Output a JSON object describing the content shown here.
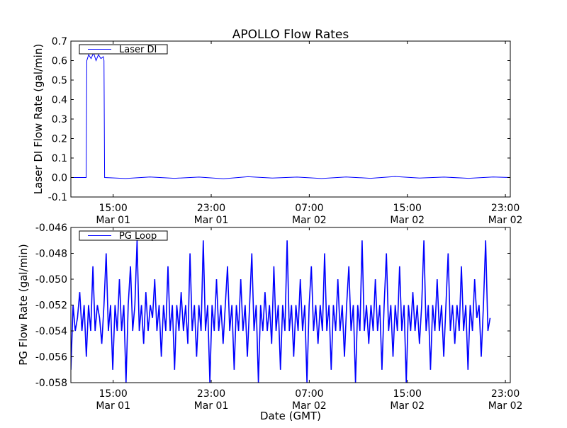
{
  "chart_data": [
    {
      "type": "line",
      "title": "APOLLO Flow Rates",
      "ylabel": "Laser DI Flow Rate (gal/min)",
      "xlabel": "",
      "x_unit": "hours since Mar 01 00:00 GMT",
      "xlim": [
        11.55,
        47.4
      ],
      "ylim": [
        -0.1,
        0.7
      ],
      "yticks": [
        "-0.1",
        "0.0",
        "0.1",
        "0.2",
        "0.3",
        "0.4",
        "0.5",
        "0.6",
        "0.7"
      ],
      "ytick_values": [
        -0.1,
        0.0,
        0.1,
        0.2,
        0.3,
        0.4,
        0.5,
        0.6,
        0.7
      ],
      "xticks": [
        {
          "value": 15,
          "time": "15:00",
          "date": "Mar 01"
        },
        {
          "value": 23,
          "time": "23:00",
          "date": "Mar 01"
        },
        {
          "value": 31,
          "time": "07:00",
          "date": "Mar 02"
        },
        {
          "value": 39,
          "time": "15:00",
          "date": "Mar 02"
        },
        {
          "value": 47,
          "time": "23:00",
          "date": "Mar 02"
        }
      ],
      "legend": {
        "position": "top-left",
        "entries": [
          "Laser DI"
        ]
      },
      "grid": false,
      "series": [
        {
          "name": "Laser DI",
          "color": "#0000ff",
          "x": [
            11.55,
            12.8,
            12.85,
            13.0,
            13.2,
            13.4,
            13.6,
            13.8,
            14.0,
            14.2,
            14.25,
            14.3,
            16,
            18,
            20,
            22,
            24,
            26,
            28,
            30,
            32,
            34,
            36,
            38,
            40,
            42,
            44,
            46,
            47.4
          ],
          "y": [
            0.0,
            0.0,
            0.6,
            0.63,
            0.61,
            0.64,
            0.6,
            0.63,
            0.61,
            0.62,
            0.6,
            0.0,
            -0.005,
            0.003,
            -0.004,
            0.002,
            -0.006,
            0.004,
            -0.003,
            0.002,
            -0.005,
            0.003,
            -0.004,
            0.005,
            -0.003,
            0.002,
            -0.004,
            0.003,
            0.0
          ]
        }
      ]
    },
    {
      "type": "line",
      "title": "",
      "ylabel": "PG Flow Rate (gal/min)",
      "xlabel": "Date (GMT)",
      "x_unit": "hours since Mar 01 00:00 GMT",
      "xlim": [
        11.55,
        47.4
      ],
      "ylim": [
        -0.058,
        -0.046
      ],
      "yticks": [
        "-0.058",
        "-0.056",
        "-0.054",
        "-0.052",
        "-0.050",
        "-0.048",
        "-0.046"
      ],
      "ytick_values": [
        -0.058,
        -0.056,
        -0.054,
        -0.052,
        -0.05,
        -0.048,
        -0.046
      ],
      "xticks": [
        {
          "value": 15,
          "time": "15:00",
          "date": "Mar 01"
        },
        {
          "value": 23,
          "time": "23:00",
          "date": "Mar 01"
        },
        {
          "value": 31,
          "time": "07:00",
          "date": "Mar 02"
        },
        {
          "value": 39,
          "time": "15:00",
          "date": "Mar 02"
        },
        {
          "value": 47,
          "time": "23:00",
          "date": "Mar 02"
        }
      ],
      "legend": {
        "position": "top-left",
        "entries": [
          "PG Loop"
        ]
      },
      "grid": false,
      "series": [
        {
          "name": "PG Loop",
          "color": "#0000ff",
          "x_start": 11.55,
          "x_step": 0.18,
          "y": [
            -0.057,
            -0.052,
            -0.054,
            -0.053,
            -0.051,
            -0.054,
            -0.052,
            -0.056,
            -0.052,
            -0.054,
            -0.049,
            -0.054,
            -0.052,
            -0.053,
            -0.055,
            -0.052,
            -0.048,
            -0.054,
            -0.052,
            -0.057,
            -0.052,
            -0.054,
            -0.05,
            -0.054,
            -0.052,
            -0.058,
            -0.052,
            -0.049,
            -0.054,
            -0.052,
            -0.047,
            -0.054,
            -0.052,
            -0.055,
            -0.051,
            -0.054,
            -0.052,
            -0.053,
            -0.05,
            -0.054,
            -0.052,
            -0.056,
            -0.052,
            -0.054,
            -0.049,
            -0.054,
            -0.052,
            -0.057,
            -0.052,
            -0.054,
            -0.051,
            -0.054,
            -0.052,
            -0.055,
            -0.048,
            -0.054,
            -0.052,
            -0.056,
            -0.052,
            -0.054,
            -0.047,
            -0.054,
            -0.052,
            -0.058,
            -0.052,
            -0.054,
            -0.05,
            -0.054,
            -0.052,
            -0.055,
            -0.052,
            -0.049,
            -0.054,
            -0.052,
            -0.057,
            -0.052,
            -0.054,
            -0.05,
            -0.054,
            -0.052,
            -0.056,
            -0.052,
            -0.048,
            -0.054,
            -0.052,
            -0.058,
            -0.052,
            -0.054,
            -0.051,
            -0.054,
            -0.052,
            -0.055,
            -0.049,
            -0.054,
            -0.052,
            -0.057,
            -0.052,
            -0.054,
            -0.047,
            -0.054,
            -0.052,
            -0.056,
            -0.052,
            -0.054,
            -0.05,
            -0.054,
            -0.052,
            -0.058,
            -0.052,
            -0.049,
            -0.054,
            -0.052,
            -0.055,
            -0.052,
            -0.054,
            -0.048,
            -0.054,
            -0.052,
            -0.057,
            -0.052,
            -0.054,
            -0.05,
            -0.054,
            -0.052,
            -0.056,
            -0.052,
            -0.049,
            -0.054,
            -0.052,
            -0.058,
            -0.052,
            -0.054,
            -0.047,
            -0.054,
            -0.052,
            -0.055,
            -0.052,
            -0.054,
            -0.05,
            -0.054,
            -0.052,
            -0.057,
            -0.052,
            -0.048,
            -0.054,
            -0.052,
            -0.056,
            -0.052,
            -0.054,
            -0.049,
            -0.054,
            -0.052,
            -0.058,
            -0.052,
            -0.054,
            -0.051,
            -0.054,
            -0.052,
            -0.055,
            -0.052,
            -0.047,
            -0.054,
            -0.052,
            -0.057,
            -0.052,
            -0.054,
            -0.05,
            -0.054,
            -0.052,
            -0.056,
            -0.052,
            -0.048,
            -0.054,
            -0.052,
            -0.055,
            -0.052,
            -0.054,
            -0.049,
            -0.054,
            -0.052,
            -0.057,
            -0.052,
            -0.054,
            -0.05,
            -0.053,
            -0.052,
            -0.056,
            -0.052,
            -0.047,
            -0.054,
            -0.053
          ]
        }
      ]
    }
  ]
}
